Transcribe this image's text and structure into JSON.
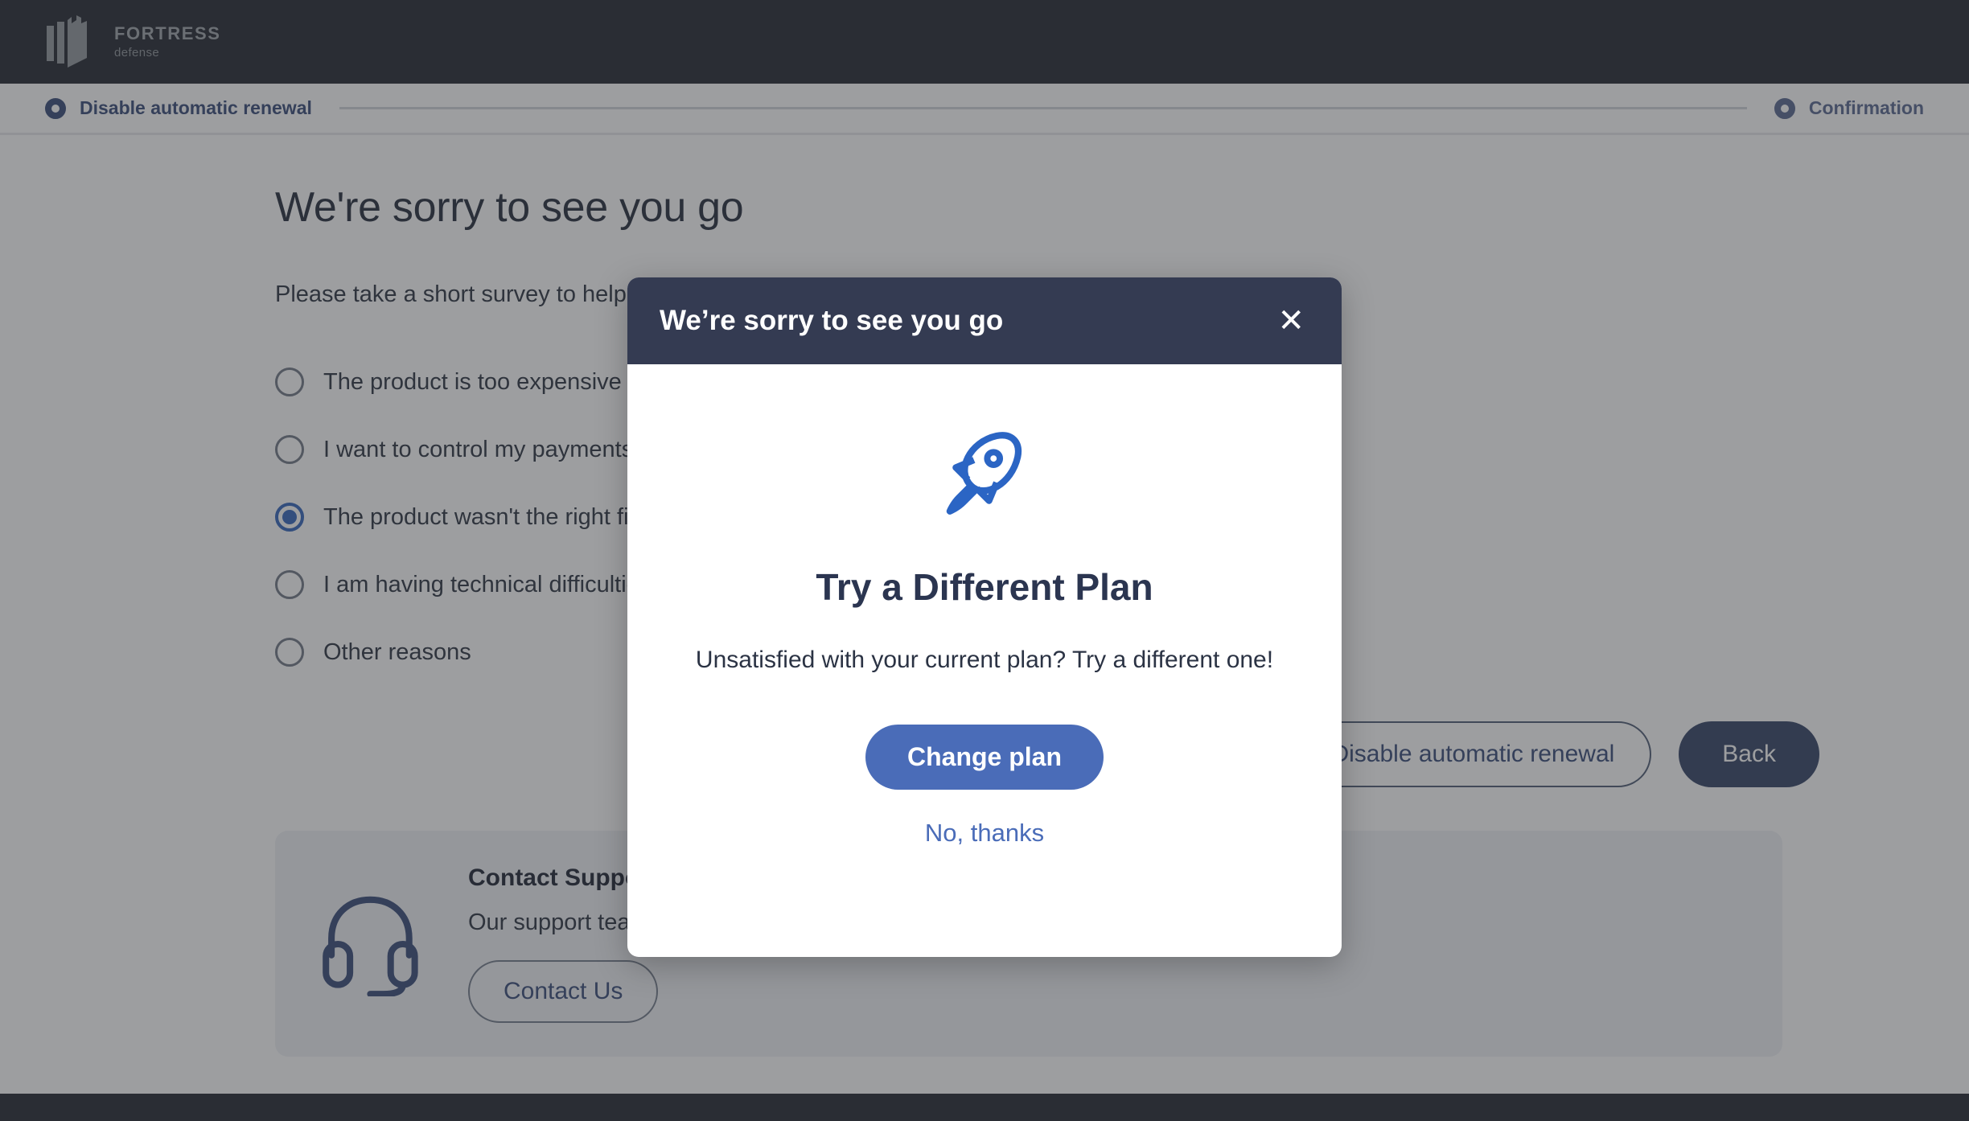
{
  "brand": {
    "logo_icon": "fortress-logo-icon",
    "name": "FORTRESS",
    "tagline": "defense"
  },
  "stepper": {
    "steps": [
      {
        "label": "Disable automatic renewal",
        "state": "active",
        "icon": "step-ring-icon"
      },
      {
        "label": "Confirmation",
        "state": "upcoming",
        "icon": "step-ring-icon"
      }
    ]
  },
  "page": {
    "title": "We're sorry to see you go",
    "subtitle": "Please take a short survey to help us improve",
    "options": [
      {
        "label": "The product is too expensive",
        "selected": false
      },
      {
        "label": "I want to control my payments",
        "selected": false
      },
      {
        "label": "The product wasn't the right fit",
        "selected": true
      },
      {
        "label": "I am having technical difficulties",
        "selected": false
      },
      {
        "label": "Other reasons",
        "selected": false
      }
    ],
    "actions": {
      "disable_label": "Disable automatic renewal",
      "back_label": "Back"
    },
    "support": {
      "icon": "headset-icon",
      "title": "Contact Support",
      "text": "Our support team is here to help you with your subscription.",
      "button_label": "Contact Us"
    }
  },
  "modal": {
    "title": "We’re sorry to see you go",
    "close_label": "✕",
    "icon": "rocket-icon",
    "heading": "Try a Different Plan",
    "description": "Unsatisfied with your current plan? Try a different one!",
    "primary_label": "Change plan",
    "secondary_label": "No, thanks"
  },
  "colors": {
    "nav_bg": "#181d27",
    "accent_blue": "#4a6cb8",
    "deep_navy": "#2e4272",
    "modal_header": "#343b52"
  }
}
